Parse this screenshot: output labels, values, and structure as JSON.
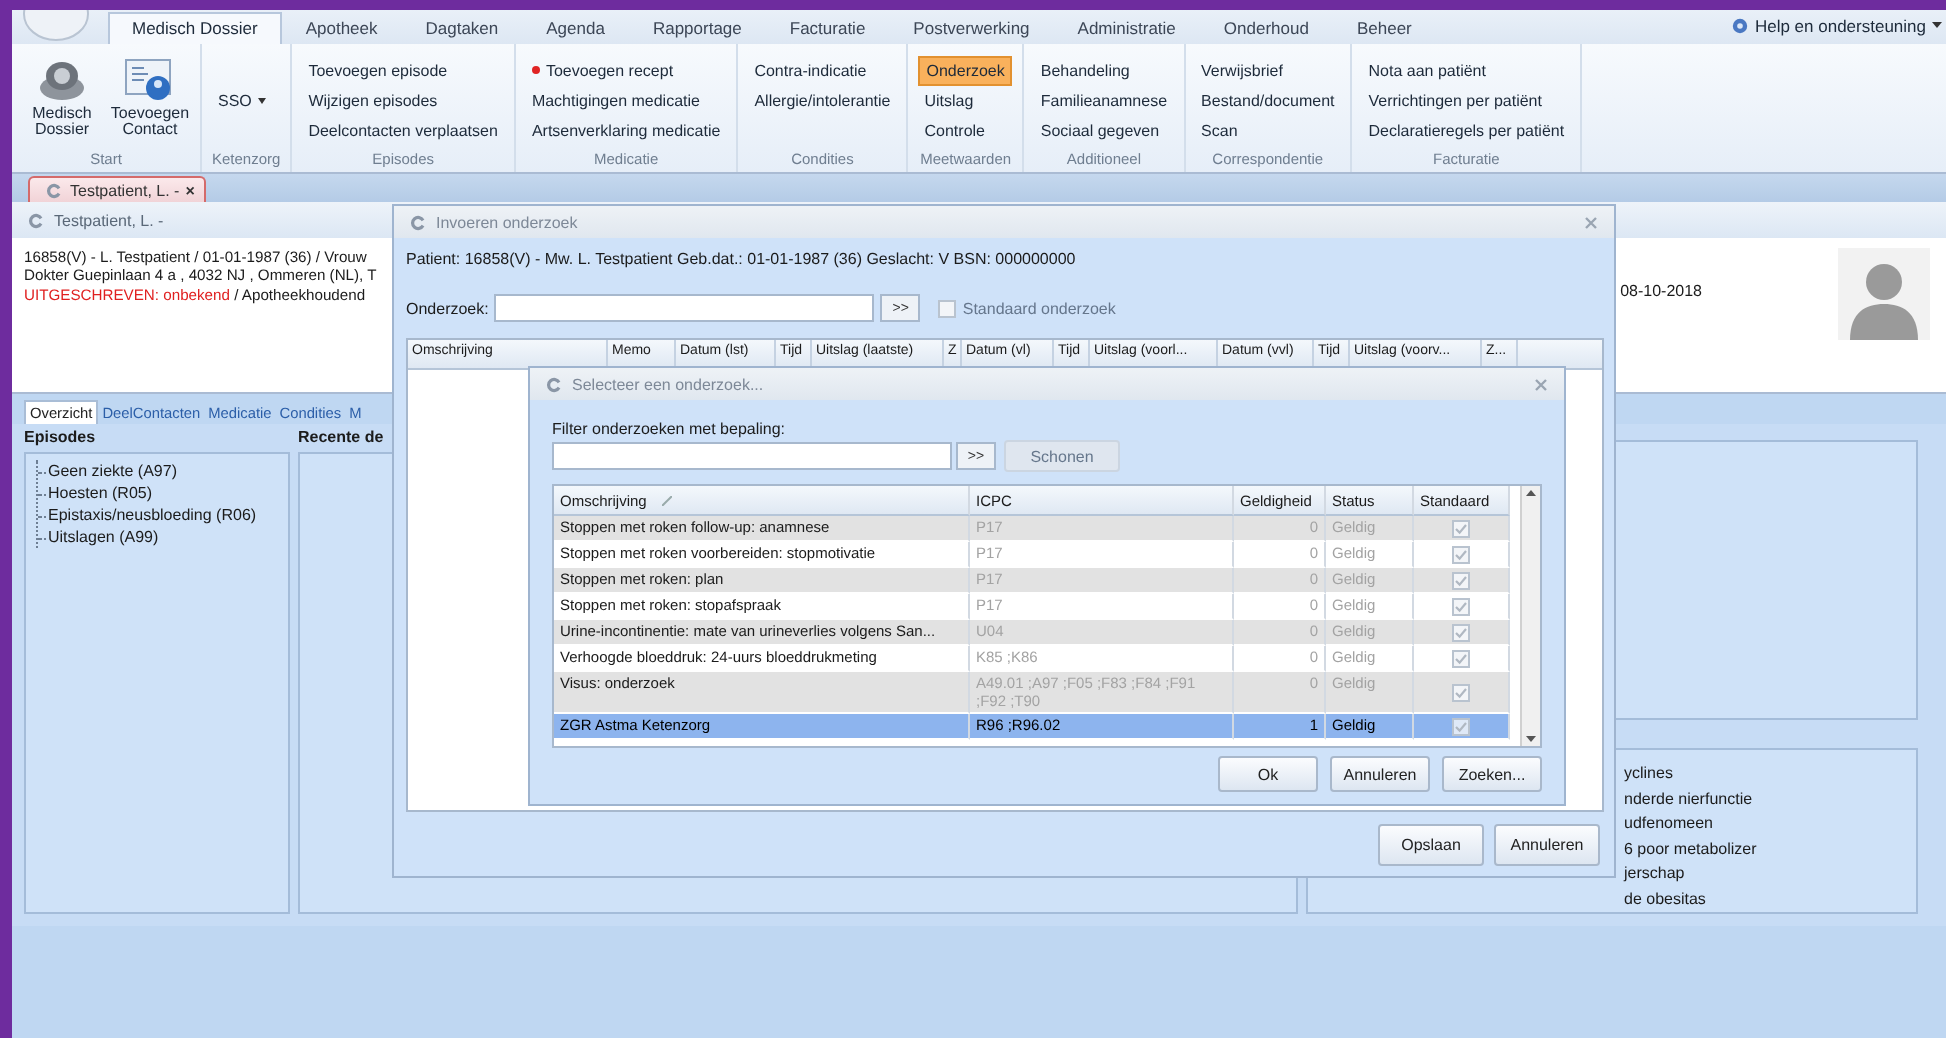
{
  "ribbon": {
    "tabs": [
      {
        "label": "Medisch Dossier",
        "selected": true
      },
      {
        "label": "Apotheek",
        "selected": false
      },
      {
        "label": "Dagtaken",
        "selected": false
      },
      {
        "label": "Agenda",
        "selected": false
      },
      {
        "label": "Rapportage",
        "selected": false
      },
      {
        "label": "Facturatie",
        "selected": false
      },
      {
        "label": "Postverwerking",
        "selected": false
      },
      {
        "label": "Administratie",
        "selected": false
      },
      {
        "label": "Onderhoud",
        "selected": false
      },
      {
        "label": "Beheer",
        "selected": false
      }
    ],
    "help": "Help en ondersteuning",
    "groups": [
      {
        "label": "Start",
        "items": [
          {
            "kind": "large",
            "label": "Medisch Dossier",
            "highlighted": false
          },
          {
            "kind": "large",
            "label": "Toevoegen Contact",
            "highlighted": false
          }
        ]
      },
      {
        "label": "Ketenzorg",
        "items": [
          {
            "kind": "dropdown",
            "label": "SSO",
            "highlighted": false
          }
        ]
      },
      {
        "label": "Episodes",
        "items": [
          {
            "kind": "text",
            "label": "Toevoegen episode",
            "highlighted": false
          },
          {
            "kind": "text",
            "label": "Wijzigen episodes",
            "highlighted": false
          },
          {
            "kind": "text",
            "label": "Deelcontacten verplaatsen",
            "highlighted": false
          }
        ]
      },
      {
        "label": "Medicatie",
        "items": [
          {
            "kind": "marked",
            "label": "Toevoegen recept",
            "highlighted": false
          },
          {
            "kind": "text",
            "label": "Machtigingen medicatie",
            "highlighted": false
          },
          {
            "kind": "text",
            "label": "Artsenverklaring medicatie",
            "highlighted": false
          }
        ]
      },
      {
        "label": "Condities",
        "items": [
          {
            "kind": "text",
            "label": "Contra-indicatie",
            "highlighted": false
          },
          {
            "kind": "text",
            "label": "Allergie/intolerantie",
            "highlighted": false
          }
        ]
      },
      {
        "label": "Meetwaarden",
        "items": [
          {
            "kind": "text",
            "label": "Onderzoek",
            "highlighted": true
          },
          {
            "kind": "text",
            "label": "Uitslag",
            "highlighted": false
          },
          {
            "kind": "text",
            "label": "Controle",
            "highlighted": false
          }
        ]
      },
      {
        "label": "Additioneel",
        "items": [
          {
            "kind": "text",
            "label": "Behandeling",
            "highlighted": false
          },
          {
            "kind": "text",
            "label": "Familieanamnese",
            "highlighted": false
          },
          {
            "kind": "text",
            "label": "Sociaal gegeven",
            "highlighted": false
          }
        ]
      },
      {
        "label": "Correspondentie",
        "items": [
          {
            "kind": "text",
            "label": "Verwijsbrief",
            "highlighted": false
          },
          {
            "kind": "text",
            "label": "Bestand/document",
            "highlighted": false
          },
          {
            "kind": "text",
            "label": "Scan",
            "highlighted": false
          }
        ]
      },
      {
        "label": "Facturatie",
        "items": [
          {
            "kind": "text",
            "label": "Nota aan patiënt",
            "highlighted": false
          },
          {
            "kind": "text",
            "label": "Verrichtingen per patiënt",
            "highlighted": false
          },
          {
            "kind": "text",
            "label": "Declaratieregels per patiënt",
            "highlighted": false
          }
        ]
      }
    ]
  },
  "document_tabs": [
    {
      "label": "Testpatient, L. -",
      "selected": true,
      "close": "×"
    }
  ],
  "patient": {
    "title": "Testpatient, L. -",
    "lines": [
      "16858(V) - L. Testpatient / 01-01-1987 (36) / Vrouw",
      "Dokter Guepinlaan 4 a , 4032 NJ , Ommeren (NL), T"
    ],
    "status": "UITGESCHREVEN: onbekend",
    "status_suffix": "/ Apotheekhoudend",
    "date": "08-10-2018",
    "tabs": [
      {
        "label": "Overzicht",
        "selected": true
      },
      {
        "label": "DeelContacten",
        "selected": false
      },
      {
        "label": "Medicatie",
        "selected": false
      },
      {
        "label": "Condities",
        "selected": false
      },
      {
        "label": "M",
        "selected": false
      }
    ],
    "episodes": {
      "title": "Episodes",
      "items": [
        {
          "label": "Geen ziekte (A97)"
        },
        {
          "label": "Hoesten (R05)"
        },
        {
          "label": "Epistaxis/neusbloeding (R06)"
        },
        {
          "label": "Uitslagen (A99)"
        }
      ]
    },
    "recent_heading": "Recente de",
    "condition_fragments": [
      "yclines",
      "nderde nierfunctie",
      "udfenomeen",
      "6 poor metabolizer",
      "jerschap",
      "de obesitas"
    ]
  },
  "entry_dialog": {
    "title": "Invoeren onderzoek",
    "patient_line": "Patient: 16858(V) - Mw. L. Testpatient Geb.dat.: 01-01-1987 (36) Geslacht: V BSN: 000000000",
    "field_label": "Onderzoek:",
    "lookup_button": ">>",
    "standard_checkbox": {
      "label": "Standaard onderzoek",
      "checked": false,
      "disabled": true
    },
    "columns": [
      "Omschrijving",
      "Memo",
      "Datum (lst)",
      "Tijd",
      "Uitslag (laatste)",
      "Z",
      "Datum (vl)",
      "Tijd",
      "Uitslag (voorl...",
      "Datum (vvl)",
      "Tijd",
      "Uitslag (voorv...",
      "Z..."
    ],
    "buttons": [
      "Opslaan",
      "Annuleren"
    ]
  },
  "select_dialog": {
    "title": "Selecteer een onderzoek...",
    "filter_label": "Filter onderzoeken met bepaling:",
    "lookup_button": ">>",
    "clear_button": {
      "label": "Schonen",
      "disabled": true
    },
    "columns": [
      "Omschrijving",
      "ICPC",
      "Geldigheid",
      "Status",
      "Standaard"
    ],
    "rows": [
      {
        "omschrijving": "Stoppen met roken follow-up: anamnese",
        "icpc": "P17",
        "geldigheid": "0",
        "status": "Geldig",
        "standaard": true,
        "selected": false
      },
      {
        "omschrijving": "Stoppen met roken voorbereiden: stopmotivatie",
        "icpc": "P17",
        "geldigheid": "0",
        "status": "Geldig",
        "standaard": true,
        "selected": false
      },
      {
        "omschrijving": "Stoppen met roken: plan",
        "icpc": "P17",
        "geldigheid": "0",
        "status": "Geldig",
        "standaard": true,
        "selected": false
      },
      {
        "omschrijving": "Stoppen met roken: stopafspraak",
        "icpc": "P17",
        "geldigheid": "0",
        "status": "Geldig",
        "standaard": true,
        "selected": false
      },
      {
        "omschrijving": "Urine-incontinentie: mate van urineverlies volgens San...",
        "icpc": "U04",
        "geldigheid": "0",
        "status": "Geldig",
        "standaard": true,
        "selected": false
      },
      {
        "omschrijving": "Verhoogde bloeddruk: 24-uurs bloeddrukmeting",
        "icpc": "K85 ;K86",
        "geldigheid": "0",
        "status": "Geldig",
        "standaard": true,
        "selected": false
      },
      {
        "omschrijving": "Visus: onderzoek",
        "icpc": "A49.01 ;A97 ;F05 ;F83 ;F84 ;F91 ;F92 ;T90",
        "geldigheid": "0",
        "status": "Geldig",
        "standaard": true,
        "selected": false
      },
      {
        "omschrijving": "ZGR Astma Ketenzorg",
        "icpc": "R96 ;R96.02",
        "geldigheid": "1",
        "status": "Geldig",
        "standaard": true,
        "selected": true
      }
    ],
    "buttons": [
      "Ok",
      "Annuleren",
      "Zoeken..."
    ]
  }
}
